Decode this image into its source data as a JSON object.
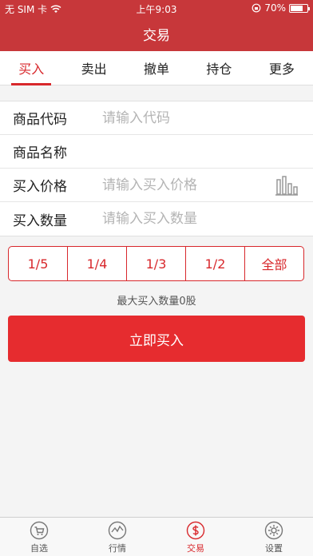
{
  "status_bar": {
    "carrier": "无 SIM 卡",
    "time": "上午9:03",
    "battery": "70%",
    "battery_level": 0.7
  },
  "header": {
    "title": "交易"
  },
  "tabs": [
    {
      "label": "买入",
      "active": true
    },
    {
      "label": "卖出",
      "active": false
    },
    {
      "label": "撤单",
      "active": false
    },
    {
      "label": "持仓",
      "active": false
    },
    {
      "label": "更多",
      "active": false
    }
  ],
  "form": {
    "code_label": "商品代码",
    "code_placeholder": "请输入代码",
    "name_label": "商品名称",
    "price_label": "买入价格",
    "price_placeholder": "请输入买入价格",
    "qty_label": "买入数量",
    "qty_placeholder": "请输入买入数量"
  },
  "fractions": [
    "1/5",
    "1/4",
    "1/3",
    "1/2",
    "全部"
  ],
  "max_qty_text": "最大买入数量0股",
  "buy_button": "立即买入",
  "bottom_nav": [
    {
      "label": "自选",
      "icon": "cart-icon",
      "active": false
    },
    {
      "label": "行情",
      "icon": "trend-icon",
      "active": false
    },
    {
      "label": "交易",
      "icon": "dollar-icon",
      "active": true
    },
    {
      "label": "设置",
      "icon": "gear-icon",
      "active": false
    }
  ],
  "colors": {
    "brand": "#c7373a",
    "accent": "#d8282c",
    "button": "#e62c2f"
  }
}
